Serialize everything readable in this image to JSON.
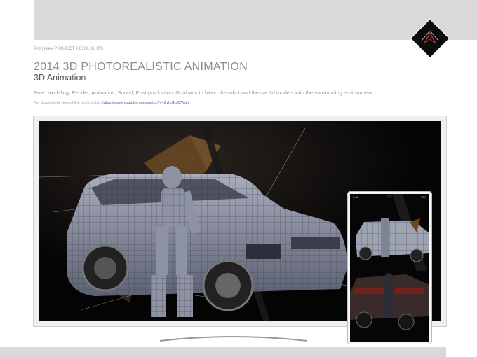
{
  "header": {
    "kicker": "ProfyAlex PROJECT HIGHLIGHTS"
  },
  "project": {
    "title": "2014 3D PHOTOREALISTIC ANIMATION",
    "subtitle": "3D Animation",
    "role": "Role: Modeling, Render, Animation, Sound, Post-production. Goal was to blend the robot and the car 3d models with the surrounding environment.",
    "visit_prefix": "For a complete view of the project visit: ",
    "visit_link": "https://www.youtube.com/watch?v=Zvl1Go32WuY"
  },
  "phone": {
    "time": "5:08",
    "battery": "79%"
  },
  "colors": {
    "band": "#d9d9d9",
    "link": "#3b5bbd",
    "logo_bg": "#0c0c0c",
    "logo_accent": "#c0322c"
  },
  "icons": {
    "logo": "brand-diamond-logo"
  }
}
